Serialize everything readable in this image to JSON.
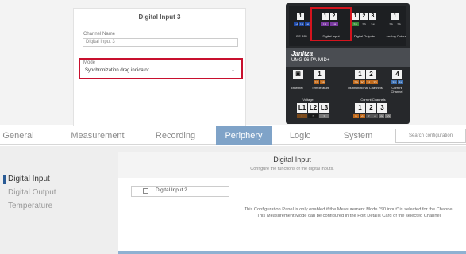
{
  "card": {
    "title": "Digital Input 3",
    "channel_name_label": "Channel Name",
    "channel_name_value": "Digital Input 3",
    "mode_label": "Mode",
    "mode_value": "Synchronization drag indicator"
  },
  "device": {
    "top_terms": [
      "1",
      "1",
      "2",
      "1",
      "2",
      "3",
      "1"
    ],
    "top_pins": [
      "14",
      "15",
      "16",
      "18",
      "19",
      "22",
      "23",
      "24",
      "25",
      "26"
    ],
    "labels": {
      "rs485": "RS-485",
      "digital_input": "Digital Input",
      "digital_outputs": "Digital Outputs",
      "analog_output": "Analog Output",
      "ethernet": "Ethernet",
      "temperature": "Temperature",
      "multifunctional": "Multifunctional Channels",
      "current_channel": "Current Channel",
      "voltage": "Voltage",
      "current_channels": "Current Channels"
    },
    "brand": "Janitza",
    "model": "UMG 96-PA-MID+",
    "mid_terms": [
      "1",
      "1",
      "2",
      "4"
    ],
    "mid_pins": [
      "27",
      "28",
      "29",
      "30",
      "31",
      "32",
      "33",
      "34"
    ],
    "volt_terms": [
      "L1",
      "L2",
      "L3"
    ],
    "volt_pins": [
      "1",
      "2",
      "3"
    ],
    "curr_terms": [
      "1",
      "2",
      "3"
    ],
    "curr_pins": [
      "5",
      "6",
      "7",
      "8",
      "9",
      "10"
    ]
  },
  "tabs": [
    "General",
    "Measurement",
    "Recording",
    "Periphery",
    "Logic",
    "System"
  ],
  "search": {
    "placeholder": "Search configuration"
  },
  "sidebar": {
    "items": [
      "Digital Input",
      "Digital Output",
      "Temperature"
    ]
  },
  "panel": {
    "title": "Digital Input",
    "subtitle": "Configure the functions of the digital inputs.",
    "checkbox_label": "Digital Input 2",
    "info": "This Configuration Panel is only enabled if the Measurement Mode \"S0 input\" is selected for the Channel. This Measurement Mode can be configured in the Port Details Card of the selected Channel."
  },
  "colors": {
    "accent": "#7fa3c8",
    "highlight": "#c8102e",
    "active_marker": "#2a5b95"
  }
}
